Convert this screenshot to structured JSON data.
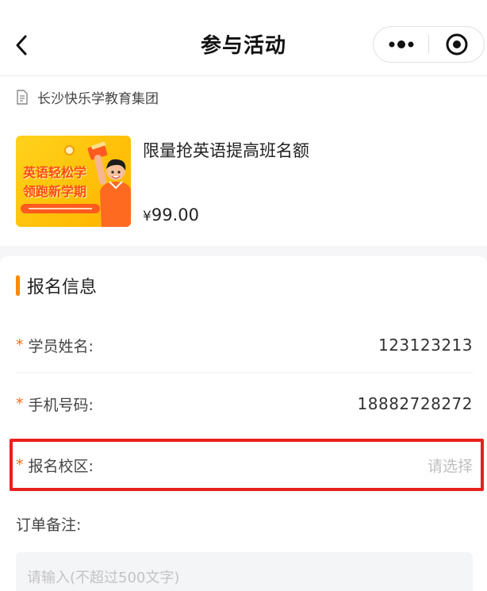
{
  "navbar": {
    "title": "参与活动",
    "back_icon": "chevron-left-icon",
    "more_icon": "more-dots-icon",
    "close_icon": "target-close-icon"
  },
  "organization": {
    "icon": "document-icon",
    "name": "长沙快乐学教育集团"
  },
  "product": {
    "thumbnail": {
      "line1": "英语轻松学",
      "line2": "领跑新学期"
    },
    "name": "限量抢英语提高班名额",
    "currency": "¥",
    "price": "99.00"
  },
  "form": {
    "section_title": "报名信息",
    "required_mark": "*",
    "fields": [
      {
        "label": "学员姓名:",
        "value": "123123213",
        "required": true
      },
      {
        "label": "手机号码:",
        "value": "18882728272",
        "required": true
      },
      {
        "label": "报名校区:",
        "placeholder": "请选择",
        "required": true
      }
    ],
    "remark": {
      "label": "订单备注:",
      "placeholder": "请输入(不超过500文字)"
    }
  },
  "colors": {
    "accent": "#ff8a00",
    "required": "#ff6a1a",
    "highlight": "#e8201c"
  }
}
